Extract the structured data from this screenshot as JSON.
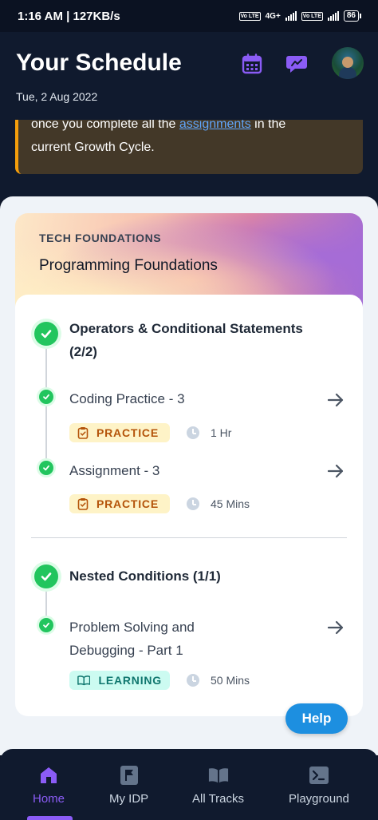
{
  "status_bar": {
    "time_speed": "1:16 AM | 127KB/s",
    "network": "4G+",
    "volte": "Vo LTE",
    "battery": "86"
  },
  "header": {
    "title": "Your Schedule",
    "date": "Tue, 2 Aug 2022",
    "icons": [
      "calendar-icon",
      "chat-icon",
      "avatar"
    ]
  },
  "notice": {
    "text_before": "once you complete all the",
    "link": "assignments",
    "text_after": " in the",
    "line2": "current Growth Cycle."
  },
  "course": {
    "kicker": "TECH FOUNDATIONS",
    "title": "Programming Foundations",
    "sections": [
      {
        "title_line1": "Operators & Conditional Statements",
        "title_line2": "(2/2)",
        "items": [
          {
            "title": "Coding Practice - 3",
            "tag": "PRACTICE",
            "duration": "1 Hr"
          },
          {
            "title": "Assignment - 3",
            "tag": "PRACTICE",
            "duration": "45 Mins"
          }
        ]
      },
      {
        "title_line1": "Nested Conditions (1/1)",
        "items": [
          {
            "title_line1": "Problem Solving and",
            "title_line2": "Debugging - Part 1",
            "tag": "LEARNING",
            "duration": "50 Mins"
          }
        ]
      }
    ]
  },
  "help_label": "Help",
  "nav": [
    {
      "label": "Home",
      "icon": "home-icon",
      "active": true
    },
    {
      "label": "My IDP",
      "icon": "flag-icon",
      "active": false
    },
    {
      "label": "All Tracks",
      "icon": "book-icon",
      "active": false
    },
    {
      "label": "Playground",
      "icon": "terminal-icon",
      "active": false
    }
  ],
  "colors": {
    "accent": "#8b5cf6",
    "success": "#22c55e",
    "practice_bg": "#fef3c7",
    "practice_text": "#b45309",
    "learning_bg": "#ccfbf1",
    "learning_text": "#0f766e",
    "help": "#1d8fe0"
  }
}
